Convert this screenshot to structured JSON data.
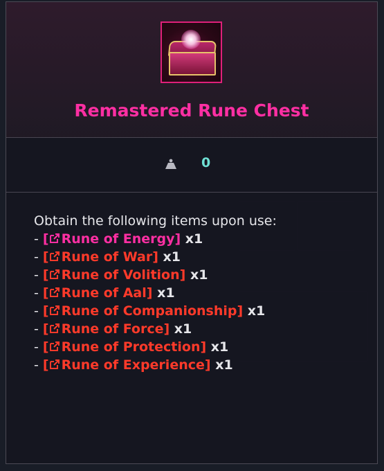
{
  "item": {
    "name": "Remastered Rune Chest",
    "icon": "rune-chest-icon",
    "name_color": "#ff2fa3",
    "weight_icon": "weight-icon",
    "weight_value": "0"
  },
  "description": {
    "intro": "Obtain the following items upon use:",
    "prefix": "- ",
    "items": [
      {
        "open": "[",
        "name": "Rune of Energy",
        "close": "]",
        "qty": " x1",
        "color": "#ff2fa3"
      },
      {
        "open": "[",
        "name": "Rune of War",
        "close": "]",
        "qty": " x1",
        "color": "#ff3a2a"
      },
      {
        "open": "[",
        "name": "Rune of Volition",
        "close": "]",
        "qty": " x1",
        "color": "#ff3a2a"
      },
      {
        "open": "[",
        "name": "Rune of Aal",
        "close": "]",
        "qty": " x1",
        "color": "#ff3a2a"
      },
      {
        "open": "[",
        "name": "Rune of Companionship",
        "close": "]",
        "qty": " x1",
        "color": "#ff3a2a"
      },
      {
        "open": "[",
        "name": "Rune of Force",
        "close": "]",
        "qty": " x1",
        "color": "#ff3a2a"
      },
      {
        "open": "[",
        "name": "Rune of Protection",
        "close": "]",
        "qty": " x1",
        "color": "#ff3a2a"
      },
      {
        "open": "[",
        "name": "Rune of Experience",
        "close": "]",
        "qty": " x1",
        "color": "#ff3a2a"
      }
    ]
  }
}
